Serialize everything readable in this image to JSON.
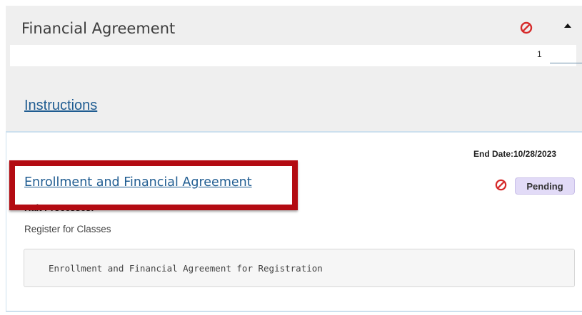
{
  "header": {
    "title": "Financial Agreement",
    "page_number": "1",
    "icons": [
      "deny-icon",
      "caret-up-icon"
    ]
  },
  "instructions": {
    "link_label": "Instructions"
  },
  "agreement": {
    "end_date": "End Date:10/28/2023",
    "title": "Enrollment and Financial Agreement",
    "status": "Pending",
    "halt_label": "Halt Processes:",
    "halt_value": "Register for Classes",
    "description": "Enrollment and Financial Agreement for Registration"
  },
  "colors": {
    "link": "#1f5c91",
    "deny_red": "#d62a2a",
    "pending_bg": "#e2dbf7",
    "highlight_red": "#b30b12",
    "panel_bg": "#efefef"
  }
}
